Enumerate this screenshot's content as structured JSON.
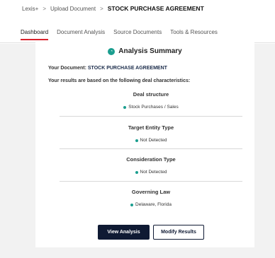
{
  "breadcrumb": {
    "items": [
      "Lexis+",
      "Upload Document",
      "STOCK PURCHASE AGREEMENT"
    ],
    "separator": ">"
  },
  "tabs": [
    {
      "label": "Dashboard",
      "active": true
    },
    {
      "label": "Document Analysis",
      "active": false
    },
    {
      "label": "Source Documents",
      "active": false
    },
    {
      "label": "Tools & Resources",
      "active": false
    }
  ],
  "summary": {
    "title": "Analysis Summary",
    "icon": "analysis-icon",
    "document_label": "Your Document:",
    "document_name": "STOCK PURCHASE AGREEMENT",
    "based_on": "Your results are based on the following deal characteristics:",
    "sections": [
      {
        "title": "Deal structure",
        "value": "Stock Purchases / Sales"
      },
      {
        "title": "Target Entity Type",
        "value": "Not Detected"
      },
      {
        "title": "Consideration Type",
        "value": "Not Detected"
      },
      {
        "title": "Governing Law",
        "value": "Delaware, Florida"
      }
    ]
  },
  "buttons": {
    "view": "View Analysis",
    "modify": "Modify Results"
  },
  "colors": {
    "accent_red": "#d9232d",
    "teal": "#1a9e8f",
    "navy": "#0f1a33"
  }
}
